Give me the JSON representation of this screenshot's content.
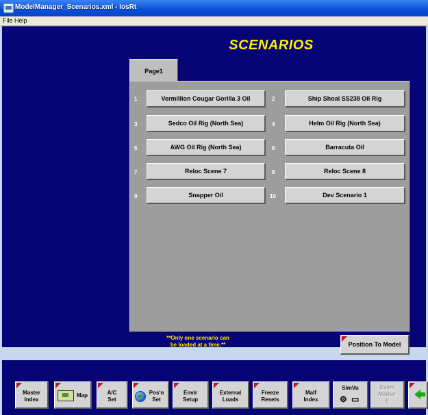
{
  "window": {
    "title": "ModelManager_Scenarios.xml - IosRt"
  },
  "menu": {
    "file": "File",
    "help": "Help"
  },
  "header": {
    "title": "SCENARIOS"
  },
  "tabs": [
    {
      "label": "Page1"
    }
  ],
  "scenarios": [
    {
      "num": "1",
      "label": "Vermillion Cougar Gorilla 3 Oil"
    },
    {
      "num": "2",
      "label": "Ship Shoal SS238 Oil Rig"
    },
    {
      "num": "3",
      "label": "Sedco Oil Rig (North Sea)"
    },
    {
      "num": "4",
      "label": "Helm Oil Rig (North Sea)"
    },
    {
      "num": "5",
      "label": "AWG Oil Rig (North Sea)"
    },
    {
      "num": "6",
      "label": "Barracuta Oil"
    },
    {
      "num": "7",
      "label": "Reloc Scene 7"
    },
    {
      "num": "8",
      "label": "Reloc Scene 8"
    },
    {
      "num": "9",
      "label": "Snapper Oil"
    },
    {
      "num": "10",
      "label": "Dev Scenario 1"
    }
  ],
  "note": {
    "line1": "**Only one scenario can",
    "line2": "be loaded at a time.**"
  },
  "position_button": {
    "label": "Position To Model"
  },
  "toolbar": {
    "master_index": {
      "line1": "Master",
      "line2": "Index"
    },
    "map": {
      "label": "Map",
      "icon": "map-icon"
    },
    "ac_set": {
      "line1": "A/C",
      "line2": "Set"
    },
    "posn_set": {
      "line1": "Pos'n",
      "line2": "Set",
      "icon": "globe-icon"
    },
    "envir_setup": {
      "line1": "Envir",
      "line2": "Setup"
    },
    "external_loads": {
      "line1": "External",
      "line2": "Loads"
    },
    "freeze_resets": {
      "line1": "Freeze",
      "line2": "Resets"
    },
    "malf_index": {
      "line1": "Malf",
      "line2": "Index"
    },
    "simvu": {
      "label": "SimVu",
      "icon": "simvu-icon"
    },
    "event_marker": {
      "line1": "Event",
      "line2": "Marker",
      "line3": "0"
    },
    "back": {
      "icon": "back-arrow-icon"
    }
  },
  "colors": {
    "background": "#070475",
    "title": "#ffef00",
    "panel": "#9d9d9d",
    "button": "#d4d4d4",
    "corner_accent": "#b21e1e"
  }
}
